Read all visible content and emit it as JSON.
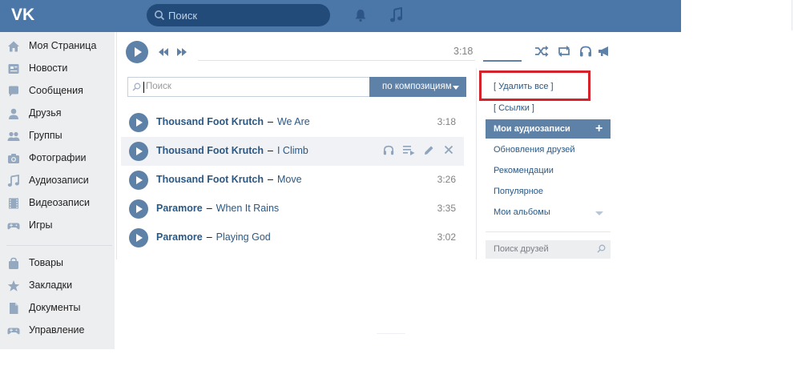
{
  "header": {
    "logo_text": "VK",
    "search_placeholder": "Поиск",
    "bg_color": "#4a76a8"
  },
  "sidebar": {
    "items": [
      {
        "label": "Моя Страница",
        "icon": "home-icon"
      },
      {
        "label": "Новости",
        "icon": "news-icon"
      },
      {
        "label": "Сообщения",
        "icon": "messages-icon"
      },
      {
        "label": "Друзья",
        "icon": "friend-icon"
      },
      {
        "label": "Группы",
        "icon": "groups-icon"
      },
      {
        "label": "Фотографии",
        "icon": "camera-icon"
      },
      {
        "label": "Аудиозаписи",
        "icon": "music-note-icon"
      },
      {
        "label": "Видеозаписи",
        "icon": "film-icon"
      },
      {
        "label": "Игры",
        "icon": "gamepad-icon"
      },
      {
        "label": "Товары",
        "icon": "bag-icon"
      },
      {
        "label": "Закладки",
        "icon": "star-icon"
      },
      {
        "label": "Документы",
        "icon": "document-icon"
      },
      {
        "label": "Управление",
        "icon": "gamepad-icon"
      }
    ]
  },
  "player": {
    "time": "3:18",
    "accent_color": "#5e81a8"
  },
  "audio_search": {
    "placeholder": "Поиск",
    "filter_label": "по композициям"
  },
  "tracks": [
    {
      "artist": "Thousand Foot Krutch",
      "title": "We Are",
      "duration": "3:18"
    },
    {
      "artist": "Thousand Foot Krutch",
      "title": "I Climb",
      "duration": ""
    },
    {
      "artist": "Thousand Foot Krutch",
      "title": "Move",
      "duration": "3:26"
    },
    {
      "artist": "Paramore",
      "title": "When It Rains",
      "duration": "3:35"
    },
    {
      "artist": "Paramore",
      "title": "Playing God",
      "duration": "3:02"
    }
  ],
  "right_menu": {
    "delete_all": "[ Удалить все ]",
    "links": "[ Ссылки ]",
    "my_audio": "Мои аудиозаписи",
    "friends_updates": "Обновления друзей",
    "recommendations": "Рекомендации",
    "popular": "Популярное",
    "my_albums": "Мои альбомы",
    "friend_search_placeholder": "Поиск друзей",
    "highlight_color": "#d5232b"
  }
}
